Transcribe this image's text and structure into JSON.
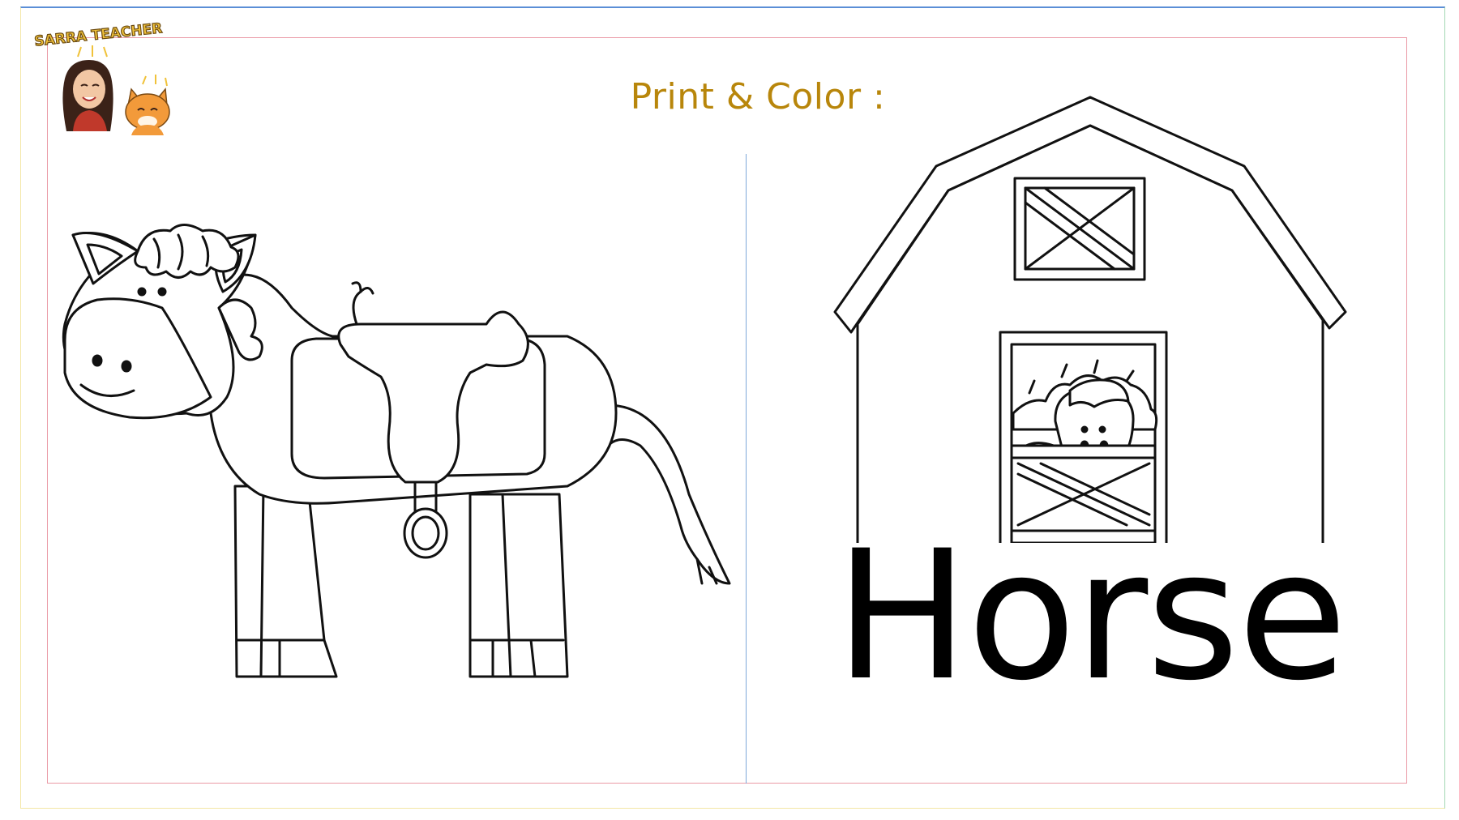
{
  "logo": {
    "text": "SARRA TEACHER"
  },
  "heading": {
    "title": "Print & Color :"
  },
  "word": {
    "label": "Horse"
  },
  "colors": {
    "title": "#b8860b",
    "frame_outer_top": "#5b8ed6",
    "frame_inner": "#ea9aa6",
    "divider": "#7da7d9"
  }
}
